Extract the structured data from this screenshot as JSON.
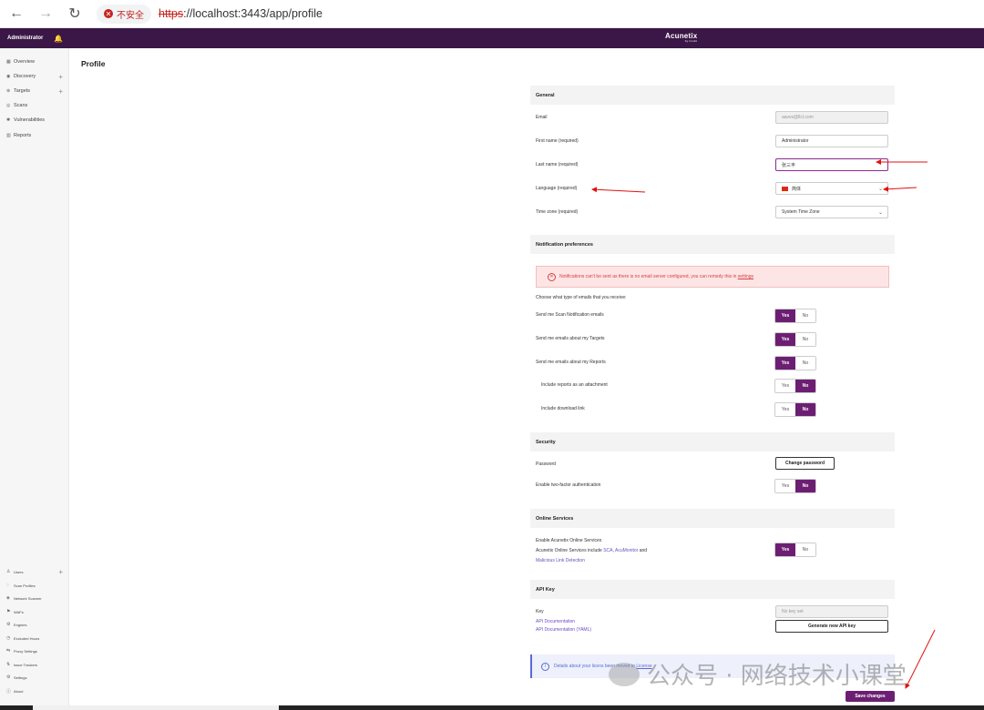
{
  "browser": {
    "insecure_label": "不安全",
    "url_scheme": "https",
    "url_rest": "://localhost:3443/app/profile"
  },
  "topbar": {
    "user": "Administrator",
    "logo": "Acunetix",
    "logo_sub": "by Invicti"
  },
  "sidebar": {
    "items": [
      {
        "label": "Overview",
        "icon": "grid-icon"
      },
      {
        "label": "Discovery",
        "icon": "discovery-icon",
        "plus": "+"
      },
      {
        "label": "Targets",
        "icon": "target-icon",
        "plus": "+"
      },
      {
        "label": "Scans",
        "icon": "scan-icon"
      },
      {
        "label": "Vulnerabilities",
        "icon": "bug-icon"
      },
      {
        "label": "Reports",
        "icon": "chart-icon"
      }
    ],
    "bottom_items": [
      {
        "label": "Users",
        "plus": "+"
      },
      {
        "label": "Scan Profiles"
      },
      {
        "label": "Network Scanner"
      },
      {
        "label": "WAFs"
      },
      {
        "label": "Engines"
      },
      {
        "label": "Excluded Hours"
      },
      {
        "label": "Proxy Settings"
      },
      {
        "label": "Issue Trackers"
      },
      {
        "label": "Settings"
      },
      {
        "label": "About"
      }
    ]
  },
  "page": {
    "title": "Profile"
  },
  "general": {
    "heading": "General",
    "email_label": "Email",
    "email_value": "aavvs@llcl.com",
    "first_name_label": "First name (required)",
    "first_name_value": "Administrator",
    "last_name_label": "Last name (required)",
    "last_name_value": "张三丰",
    "language_label": "Language (required)",
    "language_value": "简体",
    "timezone_label": "Time zone (required)",
    "timezone_value": "System Time Zone"
  },
  "notifications": {
    "heading": "Notification preferences",
    "alert_text": "Notifications can't be sent as there is no email server configured, you can remedy this in",
    "alert_link": "settings",
    "choose_text": "Choose what type of emails that you receive:",
    "yes": "Yes",
    "no": "No",
    "rows": [
      {
        "label": "Send me Scan Notification emails",
        "value": "Yes"
      },
      {
        "label": "Send me emails about my Targets",
        "value": "Yes"
      },
      {
        "label": "Send me emails about my Reports",
        "value": "Yes"
      },
      {
        "label": "Include reports as an attachment",
        "value": "No"
      },
      {
        "label": "Include download link",
        "value": "No"
      }
    ]
  },
  "security": {
    "heading": "Security",
    "password_label": "Password",
    "change_password": "Change password",
    "twofa_label": "Enable two-factor authentication",
    "twofa_value": "No"
  },
  "online": {
    "heading": "Online Services",
    "enable_label": "Enable Acunetix Online Services",
    "desc_prefix": "Acunetix Online Services include",
    "sca": "SCA",
    "acumonitor": "AcuMonitor",
    "desc_and": "and",
    "malicious": "Malicious Link Detection",
    "value": "Yes"
  },
  "api": {
    "heading": "API Key",
    "key_label": "Key",
    "doc_link": "API Documentation",
    "doc_yaml_link": "API Documentation (YAML)",
    "key_placeholder": "No key set",
    "generate_button": "Generate new API key"
  },
  "info": {
    "text": "Details about your licens",
    "text2": "been moved to",
    "link": "License"
  },
  "save_button": "Save changes",
  "watermark": "公众号 · 网络技术小课堂",
  "colors": {
    "brand": "#3a1746",
    "accent": "#6c1f72",
    "annotation": "#e01010"
  }
}
